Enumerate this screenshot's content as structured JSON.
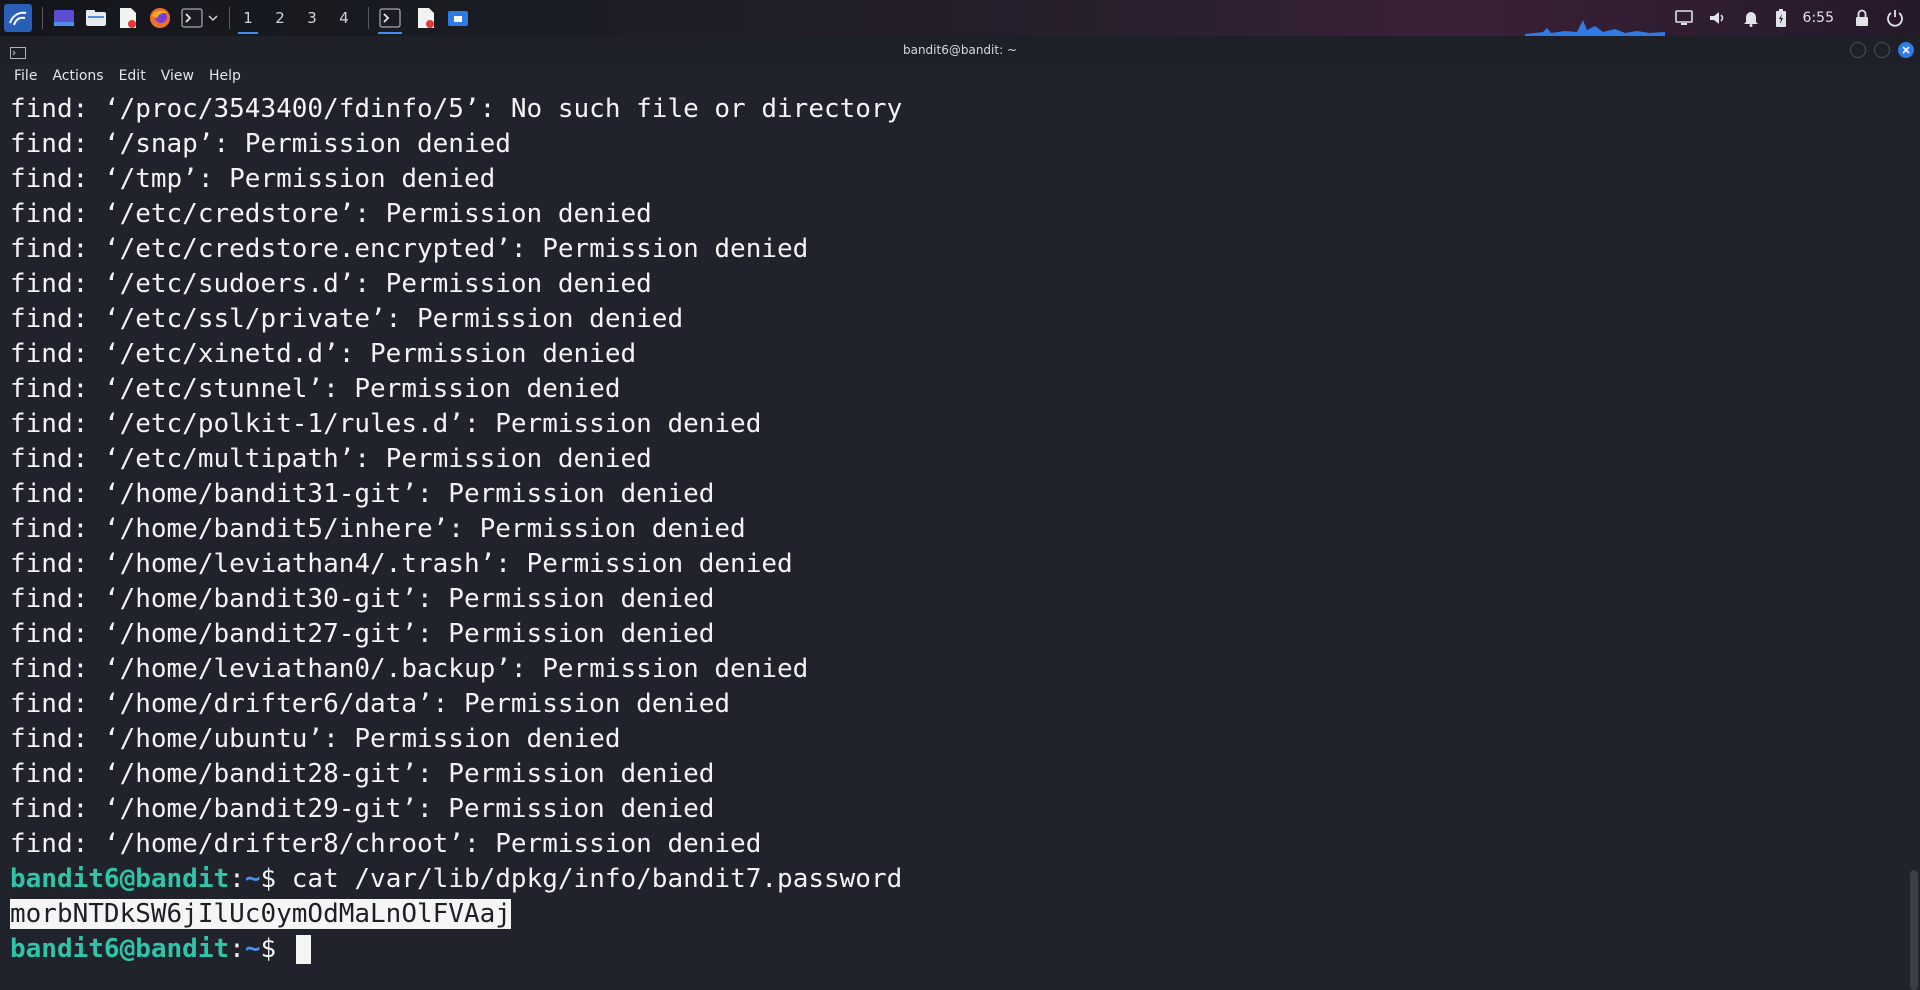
{
  "taskbar": {
    "workspaces": [
      "1",
      "2",
      "3",
      "4"
    ],
    "active_workspace": "1",
    "clock": "6:55"
  },
  "window": {
    "title": "bandit6@bandit: ~",
    "menu": [
      "File",
      "Actions",
      "Edit",
      "View",
      "Help"
    ]
  },
  "terminal": {
    "find_lines": [
      "find: ‘/proc/3543400/fdinfo/5’: No such file or directory",
      "find: ‘/snap’: Permission denied",
      "find: ‘/tmp’: Permission denied",
      "find: ‘/etc/credstore’: Permission denied",
      "find: ‘/etc/credstore.encrypted’: Permission denied",
      "find: ‘/etc/sudoers.d’: Permission denied",
      "find: ‘/etc/ssl/private’: Permission denied",
      "find: ‘/etc/xinetd.d’: Permission denied",
      "find: ‘/etc/stunnel’: Permission denied",
      "find: ‘/etc/polkit-1/rules.d’: Permission denied",
      "find: ‘/etc/multipath’: Permission denied",
      "find: ‘/home/bandit31-git’: Permission denied",
      "find: ‘/home/bandit5/inhere’: Permission denied",
      "find: ‘/home/leviathan4/.trash’: Permission denied",
      "find: ‘/home/bandit30-git’: Permission denied",
      "find: ‘/home/bandit27-git’: Permission denied",
      "find: ‘/home/leviathan0/.backup’: Permission denied",
      "find: ‘/home/drifter6/data’: Permission denied",
      "find: ‘/home/ubuntu’: Permission denied",
      "find: ‘/home/bandit28-git’: Permission denied",
      "find: ‘/home/bandit29-git’: Permission denied",
      "find: ‘/home/drifter8/chroot’: Permission denied"
    ],
    "prompt_user": "bandit6@bandit",
    "prompt_sep": ":",
    "prompt_path": "~",
    "prompt_symbol": "$ ",
    "command": "cat /var/lib/dpkg/info/bandit7.password",
    "password_output": "morbNTDkSW6jIlUc0ymOdMaLnOlFVAaj"
  },
  "colors": {
    "prompt_user": "#2ec5a8",
    "prompt_path": "#4a8ff0",
    "accent": "#2f7be6"
  },
  "icons": [
    "kali-menu-icon",
    "desktop-icon",
    "file-manager-icon",
    "text-editor-icon",
    "firefox-icon",
    "terminal-icon",
    "chevron-down-icon",
    "volume-icon",
    "bell-icon",
    "battery-icon",
    "lock-icon"
  ]
}
